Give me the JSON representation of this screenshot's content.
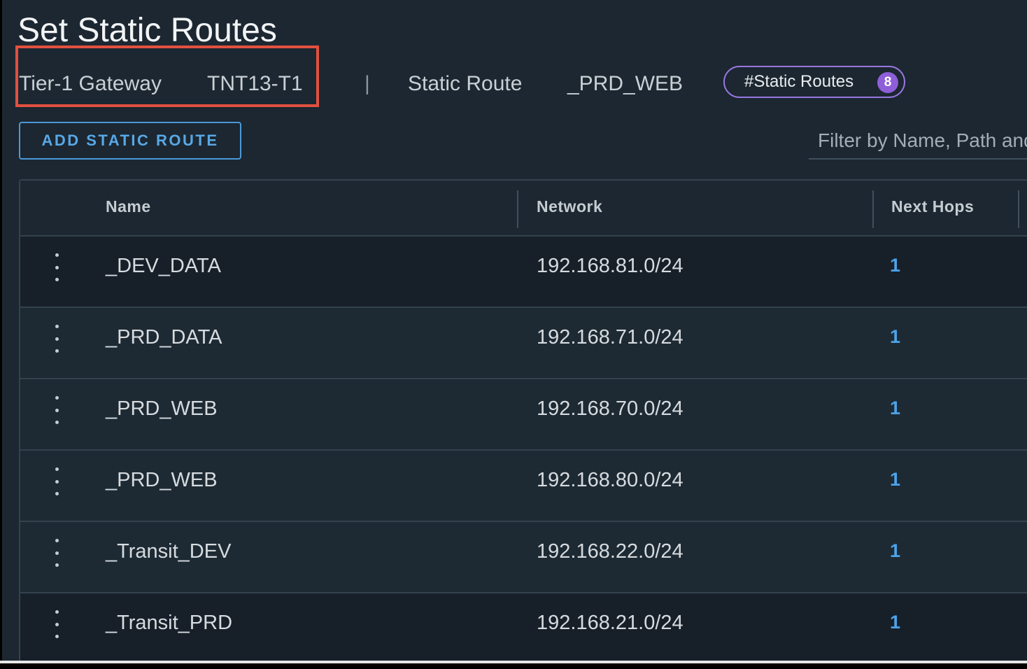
{
  "page": {
    "title": "Set Static Routes"
  },
  "context": {
    "gateway_label": "Tier-1 Gateway",
    "gateway_value": "TNT13-T1",
    "separator": "|",
    "route_label": "Static Route",
    "route_value": "_PRD_WEB",
    "count_label": "#Static Routes",
    "count_value": "8"
  },
  "toolbar": {
    "add_button_label": "ADD STATIC ROUTE",
    "filter_placeholder": "Filter by Name, Path and more"
  },
  "table": {
    "columns": [
      "Name",
      "Network",
      "Next Hops"
    ],
    "rows": [
      {
        "name": "_DEV_DATA",
        "network": "192.168.81.0/24",
        "next_hops": "1"
      },
      {
        "name": "_PRD_DATA",
        "network": "192.168.71.0/24",
        "next_hops": "1"
      },
      {
        "name": "_PRD_WEB",
        "network": "192.168.70.0/24",
        "next_hops": "1"
      },
      {
        "name": "_PRD_WEB",
        "network": "192.168.80.0/24",
        "next_hops": "1"
      },
      {
        "name": "_Transit_DEV",
        "network": "192.168.22.0/24",
        "next_hops": "1"
      },
      {
        "name": "_Transit_PRD",
        "network": "192.168.21.0/24",
        "next_hops": "1"
      }
    ]
  },
  "colors": {
    "background": "#1c2731",
    "accent_blue": "#4ca3ea",
    "badge_purple": "#8e5fd8",
    "highlight_red": "#e2503f"
  }
}
